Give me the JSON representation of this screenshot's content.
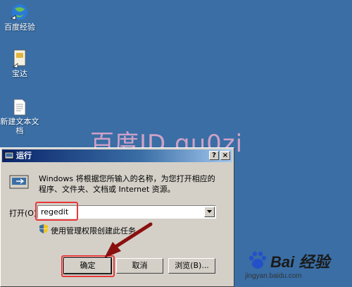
{
  "desktop": {
    "icons": [
      {
        "label": "百度经验"
      },
      {
        "label": "宝达"
      },
      {
        "label": "新建文本文档"
      }
    ]
  },
  "watermark": {
    "text": "百度ID gu0zi"
  },
  "run_dialog": {
    "title": "运行",
    "help_label": "?",
    "close_label": "×",
    "description": "Windows 将根据您所输入的名称，为您打开相应的程序、文件夹、文档或 Internet 资源。",
    "open_label": "打开(O):",
    "open_value": "regedit",
    "admin_note": "使用管理权限创建此任务。",
    "buttons": {
      "ok": "确定",
      "cancel": "取消",
      "browse": "浏览(B)..."
    }
  },
  "logo": {
    "brand": "Bai 经验",
    "url": "jingyan.baidu.com"
  },
  "colors": {
    "desktop": "#3a6ea5",
    "highlight": "#e8383b",
    "arrow": "#8a1010",
    "title_start": "#0a246a",
    "title_end": "#a6caf0"
  }
}
